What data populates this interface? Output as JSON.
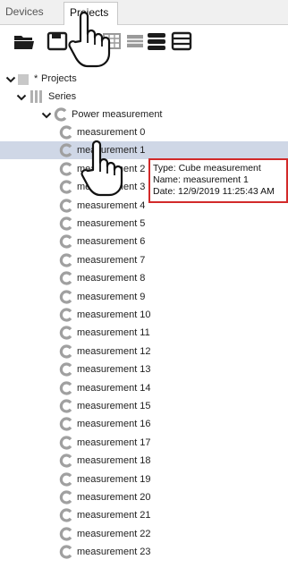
{
  "tabs": [
    {
      "label": "Devices",
      "active": false
    },
    {
      "label": "Projects",
      "active": true
    }
  ],
  "toolbar_icons": [
    "folder-open-icon",
    "save-icon",
    "grid-icon",
    "table-icon",
    "database-icon",
    "list-icon"
  ],
  "tree": {
    "root": {
      "marker": "*",
      "label": "Projects"
    },
    "series": {
      "label": "Series"
    },
    "group": {
      "label": "Power measurement"
    },
    "items": [
      "measurement 0",
      "measurement 1",
      "measurement 2",
      "measurement 3",
      "measurement 4",
      "measurement 5",
      "measurement 6",
      "measurement 7",
      "measurement 8",
      "measurement 9",
      "measurement 10",
      "measurement 11",
      "measurement 12",
      "measurement 13",
      "measurement 14",
      "measurement 15",
      "measurement 16",
      "measurement 17",
      "measurement 18",
      "measurement 19",
      "measurement 20",
      "measurement 21",
      "measurement 22",
      "measurement 23"
    ],
    "selected_index": 1
  },
  "tooltip": {
    "line1": "Type: Cube measurement",
    "line2": "Name: measurement 1",
    "line3": "Date: 12/9/2019 11:25:43 AM"
  },
  "colors": {
    "selection": "#cfd7e6",
    "tooltip_border": "#d22a2a",
    "icon_gray": "#9a9a9a",
    "dark_icon": "#1c1c1c"
  }
}
